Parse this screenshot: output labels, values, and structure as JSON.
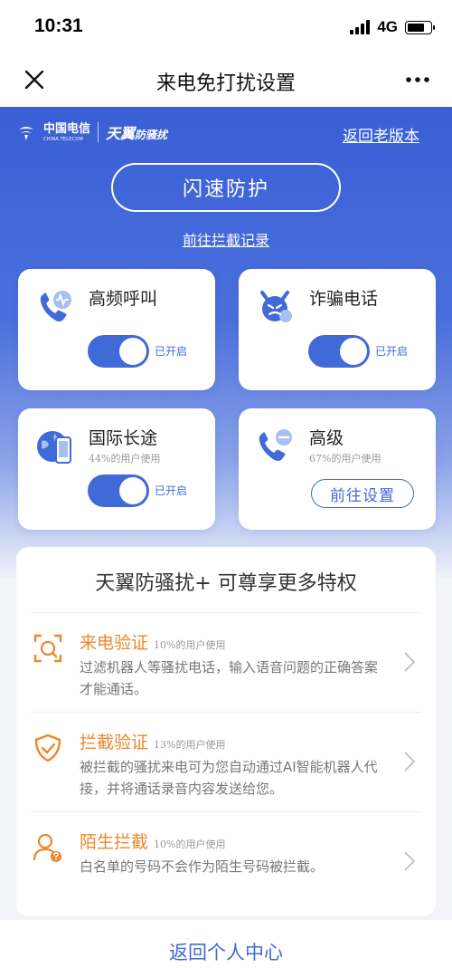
{
  "status": {
    "time": "10:31",
    "network": "4G"
  },
  "nav": {
    "title": "来电免打扰设置"
  },
  "hero": {
    "logo_carrier": "中国电信",
    "logo_carrier_en": "CHINA TELECOM",
    "logo_brand": "天翼",
    "logo_brand_sub": "防骚扰",
    "back_old_version": "返回老版本",
    "flash_protect": "闪速防护",
    "goto_records": "前往拦截记录"
  },
  "features": [
    {
      "title": "高频呼叫",
      "toggle_on": true,
      "toggle_label": "已开启",
      "icon": "phone-alert-icon"
    },
    {
      "title": "诈骗电话",
      "toggle_on": true,
      "toggle_label": "已开启",
      "icon": "devil-face-icon"
    },
    {
      "title": "国际长途",
      "usage": "44%的用户使用",
      "toggle_on": true,
      "toggle_label": "已开启",
      "icon": "globe-phone-icon"
    },
    {
      "title": "高级",
      "usage": "67%的用户使用",
      "button": "前往设置",
      "icon": "phone-minus-icon"
    }
  ],
  "perks": {
    "title": "天翼防骚扰+ 可尊享更多特权",
    "items": [
      {
        "name": "来电验证",
        "usage": "10%的用户使用",
        "desc": "过滤机器人等骚扰电话，输入语音问题的正确答案才能通话。",
        "icon": "scan-face-icon"
      },
      {
        "name": "拦截验证",
        "usage": "13%的用户使用",
        "desc": "被拦截的骚扰来电可为您自动通过AI智能机器人代接，并将通话录音内容发送给您。",
        "icon": "shield-check-icon"
      },
      {
        "name": "陌生拦截",
        "usage": "10%的用户使用",
        "desc": "白名单的号码不会作为陌生号码被拦截。",
        "icon": "user-question-icon"
      }
    ]
  },
  "footer": {
    "link": "返回个人中心"
  },
  "colors": {
    "primary": "#3f6ad8",
    "accent": "#f0862a"
  }
}
